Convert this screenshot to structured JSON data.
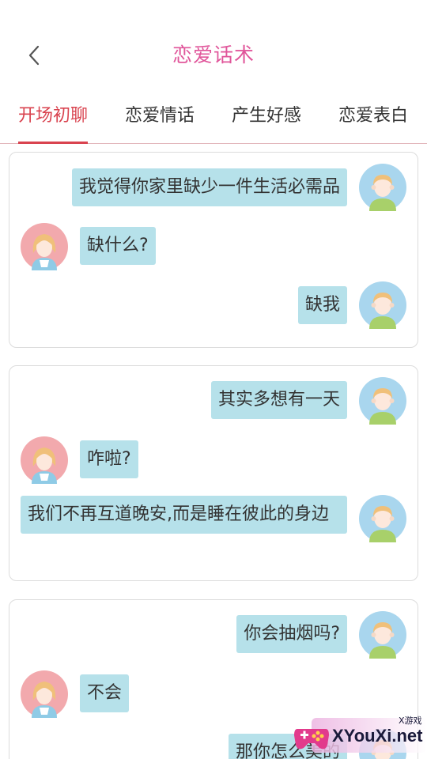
{
  "header": {
    "title": "恋爱话术",
    "back_icon": "chevron-left-icon"
  },
  "tabs": [
    {
      "label": "开场初聊",
      "active": true
    },
    {
      "label": "恋爱情话",
      "active": false
    },
    {
      "label": "产生好感",
      "active": false
    },
    {
      "label": "恋爱表白",
      "active": false
    }
  ],
  "colors": {
    "title": "#e0559a",
    "tab_active": "#d9434f",
    "bubble": "#b6e1ea",
    "avatar_male_bg": "#a9d6ee",
    "avatar_female_bg": "#f2a9ad"
  },
  "conversations": [
    {
      "messages": [
        {
          "sender": "male",
          "text": "我觉得你家里缺少一件生活必需品"
        },
        {
          "sender": "female",
          "text": "缺什么?"
        },
        {
          "sender": "male",
          "text": "缺我"
        }
      ]
    },
    {
      "messages": [
        {
          "sender": "male",
          "text": "其实多想有一天"
        },
        {
          "sender": "female",
          "text": "咋啦?"
        },
        {
          "sender": "male",
          "text": "我们不再互道晚安,而是睡在彼此的身边"
        }
      ]
    },
    {
      "messages": [
        {
          "sender": "male",
          "text": "你会抽烟吗?"
        },
        {
          "sender": "female",
          "text": "不会"
        },
        {
          "sender": "male",
          "text": "那你怎么美的"
        }
      ]
    }
  ],
  "watermark": {
    "brand": "XYouXi.net",
    "small": "X游戏"
  }
}
